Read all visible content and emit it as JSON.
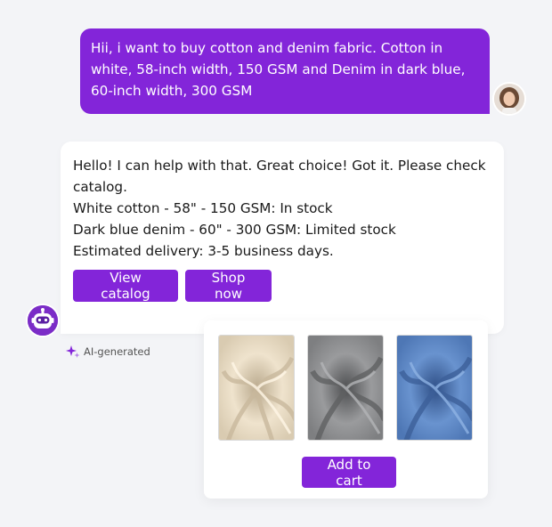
{
  "user_message": {
    "text": "Hii, i want to buy cotton and denim fabric. Cotton in white, 58-inch width, 150 GSM and Denim in dark blue, 60-inch width, 300 GSM"
  },
  "bot_message": {
    "line1": "Hello! I can help with that. Great choice! Got it. Please check catalog.",
    "line2": "White cotton - 58\" - 150 GSM: In stock",
    "line3": "Dark blue denim - 60\" - 300 GSM: Limited stock",
    "line4": "Estimated delivery: 3-5 business days."
  },
  "buttons": {
    "view_catalog": "View catalog",
    "shop_now": "Shop now",
    "add_to_cart": "Add to cart"
  },
  "ai_tag": {
    "label": "AI-generated",
    "icon": "sparkle-icon"
  },
  "products": [
    {
      "name": "white-cotton",
      "color": "#e8dcc6"
    },
    {
      "name": "grey-fabric",
      "color": "#8f9092"
    },
    {
      "name": "blue-denim",
      "color": "#5b86c4"
    }
  ],
  "colors": {
    "accent": "#8325d9",
    "background": "#f3f4f7"
  }
}
